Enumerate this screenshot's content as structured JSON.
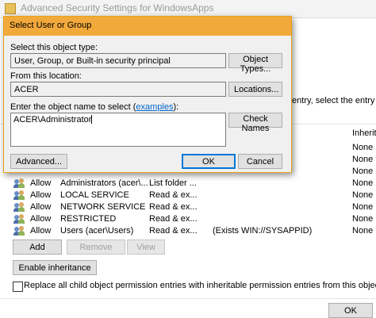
{
  "background_window": {
    "title": "Advanced Security Settings for WindowsApps",
    "hint_text": "entry, select the entry and",
    "inherited_header": "Inherite",
    "permission_rows": [
      {
        "type": "",
        "principal": "",
        "access": "",
        "condition": "",
        "inherited": "None"
      },
      {
        "type": "",
        "principal": "",
        "access": "",
        "condition": "",
        "inherited": "None"
      },
      {
        "type": "",
        "principal": "",
        "access": "",
        "condition": "",
        "inherited": "None"
      },
      {
        "type": "Allow",
        "principal": "Administrators (acer\\...",
        "access": "List folder ...",
        "condition": "",
        "inherited": "None"
      },
      {
        "type": "Allow",
        "principal": "LOCAL SERVICE",
        "access": "Read & ex...",
        "condition": "",
        "inherited": "None"
      },
      {
        "type": "Allow",
        "principal": "NETWORK SERVICE",
        "access": "Read & ex...",
        "condition": "",
        "inherited": "None"
      },
      {
        "type": "Allow",
        "principal": "RESTRICTED",
        "access": "Read & ex...",
        "condition": "",
        "inherited": "None"
      },
      {
        "type": "Allow",
        "principal": "Users (acer\\Users)",
        "access": "Read & ex...",
        "condition": "(Exists WIN://SYSAPPID)",
        "inherited": "None"
      }
    ],
    "buttons": {
      "add": "Add",
      "remove": "Remove",
      "view": "View",
      "enable_inheritance": "Enable inheritance",
      "ok": "OK"
    },
    "replace_checkbox_label": "Replace all child object permission entries with inheritable permission entries from this object"
  },
  "dialog": {
    "title": "Select User or Group",
    "object_type_label": "Select this object type:",
    "object_type_value": "User, Group, or Built-in security principal",
    "object_types_button": "Object Types...",
    "location_label": "From this location:",
    "location_value": "ACER",
    "locations_button": "Locations...",
    "object_name_label_prefix": "Enter the object name to select (",
    "object_name_label_link": "examples",
    "object_name_label_suffix": "):",
    "object_name_value": "ACER\\Administrator",
    "check_names_button": "Check Names",
    "advanced_button": "Advanced...",
    "ok_button": "OK",
    "cancel_button": "Cancel"
  }
}
